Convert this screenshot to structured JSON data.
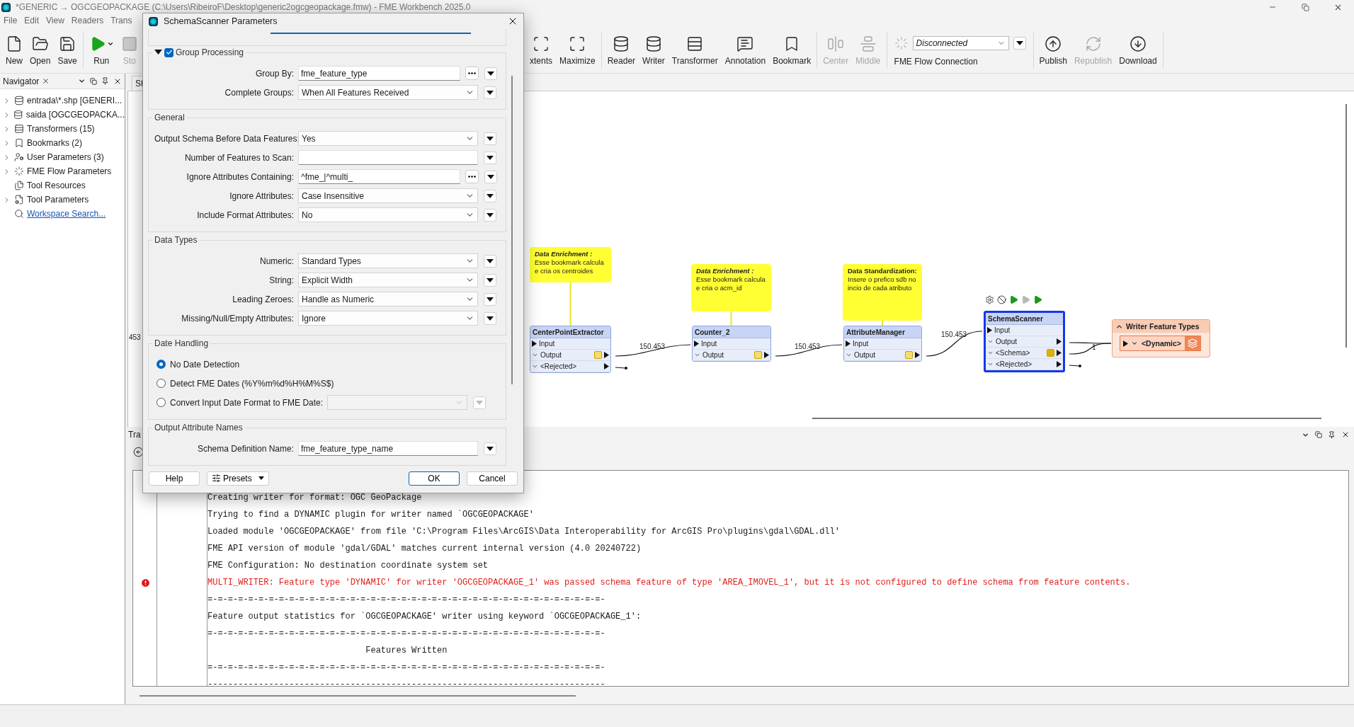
{
  "window": {
    "title": "*GENERIC → OGCGEOPACKAGE (C:\\Users\\RibeiroF\\Desktop\\generic2ogcgeopackage.fmw) - FME Workbench 2025.0"
  },
  "menu": [
    "File",
    "Edit",
    "View",
    "Readers",
    "Trans"
  ],
  "toolbar": {
    "groups": [
      {
        "items": [
          {
            "kind": "new",
            "label": "New",
            "disabled": false
          },
          {
            "kind": "open",
            "label": "Open",
            "disabled": false
          },
          {
            "kind": "save",
            "label": "Save",
            "disabled": false
          }
        ]
      },
      {
        "items": [
          {
            "kind": "run",
            "label": "Run",
            "disabled": false
          },
          {
            "kind": "stop",
            "label": "Sto",
            "disabled": true
          }
        ]
      },
      {
        "items": [
          {
            "kind": "extents",
            "label": "xtents",
            "disabled": false
          },
          {
            "kind": "maximize",
            "label": "Maximize",
            "disabled": false
          }
        ]
      },
      {
        "items": [
          {
            "kind": "reader",
            "label": "Reader",
            "disabled": false
          },
          {
            "kind": "writer",
            "label": "Writer",
            "disabled": false
          },
          {
            "kind": "transformer",
            "label": "Transformer",
            "disabled": false
          },
          {
            "kind": "annotation",
            "label": "Annotation",
            "disabled": false
          },
          {
            "kind": "bookmark",
            "label": "Bookmark",
            "disabled": false
          }
        ]
      },
      {
        "items": [
          {
            "kind": "center",
            "label": "Center",
            "disabled": true
          },
          {
            "kind": "middle",
            "label": "Middle",
            "disabled": true
          }
        ]
      }
    ],
    "flow_connection": {
      "value": "Disconnected",
      "label": "FME Flow Connection",
      "connected": false
    },
    "publish": {
      "items": [
        {
          "kind": "publish",
          "label": "Publish",
          "disabled": false
        },
        {
          "kind": "republish",
          "label": "Republish",
          "disabled": true
        },
        {
          "kind": "download",
          "label": "Download",
          "disabled": false
        }
      ]
    }
  },
  "navigator": {
    "title": "Navigator",
    "items": [
      {
        "kind": "reader",
        "label": "entrada\\*.shp [GENERI...",
        "expandable": true
      },
      {
        "kind": "writer",
        "label": "saida [OGCGEOPACKA...",
        "expandable": true
      },
      {
        "kind": "transformers",
        "label": "Transformers (15)",
        "expandable": true
      },
      {
        "kind": "bookmarks",
        "label": "Bookmarks (2)",
        "expandable": true
      },
      {
        "kind": "user_parameters",
        "label": "User Parameters (3)",
        "expandable": true
      },
      {
        "kind": "flow_parameters",
        "label": "FME Flow Parameters",
        "expandable": true
      },
      {
        "kind": "resources",
        "label": "Tool Resources",
        "expandable": false
      },
      {
        "kind": "tool_parameters",
        "label": "Tool Parameters",
        "expandable": true
      },
      {
        "kind": "link",
        "label": "Workspace Search...",
        "expandable": false
      }
    ]
  },
  "canvas": {
    "tab": "St",
    "edge_label": "453",
    "annotations": [
      {
        "title": "Data Enrichment :",
        "italic": true,
        "body": "Esse bookmark calcula e cria os centroides"
      },
      {
        "title": "Data Enrichment :",
        "italic": true,
        "body": "Esse bookmark calcula e cria o acm_id"
      },
      {
        "title": "Data Standardization:",
        "italic": false,
        "body": "Insere o prefico sdb no incio de cada atributo"
      }
    ],
    "nodes": [
      {
        "name": "CenterPointExtractor",
        "selected": false,
        "ports": [
          {
            "kind": "input",
            "label": "Input"
          },
          {
            "kind": "output",
            "label": "Output",
            "cached": true,
            "stale": true
          },
          {
            "kind": "output",
            "label": "<Rejected>",
            "cached": false
          }
        ]
      },
      {
        "name": "Counter_2",
        "selected": false,
        "ports": [
          {
            "kind": "input",
            "label": "Input"
          },
          {
            "kind": "output",
            "label": "Output",
            "cached": true,
            "stale": true
          }
        ]
      },
      {
        "name": "AttributeManager",
        "selected": false,
        "ports": [
          {
            "kind": "input",
            "label": "Input"
          },
          {
            "kind": "output",
            "label": "Output",
            "cached": true,
            "stale": true
          }
        ]
      },
      {
        "name": "SchemaScanner",
        "selected": true,
        "ports": [
          {
            "kind": "input",
            "label": "Input"
          },
          {
            "kind": "output",
            "label": "Output",
            "cached": false
          },
          {
            "kind": "output",
            "label": "<Schema>",
            "cached": true,
            "stale": false
          },
          {
            "kind": "output",
            "label": "<Rejected>",
            "cached": false
          }
        ]
      }
    ],
    "links": [
      {
        "count": "150.453"
      },
      {
        "count": "150.453"
      },
      {
        "count": "150.453"
      },
      {
        "count": "1"
      }
    ],
    "writer": {
      "title": "Writer Feature Types",
      "expanded": true,
      "feature_type": "<Dynamic>"
    }
  },
  "bottom_panel": {
    "tab": "Tra",
    "log": [
      {
        "kind": "info",
        "text": "Creating writer for format: OGC GeoPackage"
      },
      {
        "kind": "info",
        "text": "Trying to find a DYNAMIC plugin for writer named `OGCGEOPACKAGE'"
      },
      {
        "kind": "info",
        "text": "Loaded module 'OGCGEOPACKAGE' from file 'C:\\Program Files\\ArcGIS\\Data Interoperability for ArcGIS Pro\\plugins\\gdal\\GDAL.dll'"
      },
      {
        "kind": "info",
        "text": "FME API version of module 'gdal/GDAL' matches current internal version (4.0 20240722)"
      },
      {
        "kind": "info",
        "text": "FME Configuration: No destination coordinate system set"
      },
      {
        "kind": "error",
        "text": "MULTI_WRITER: Feature type 'DYNAMIC' for writer 'OGCGEOPACKAGE_1' was passed schema feature of type 'AREA_IMOVEL_1', but it is not configured to define schema from feature contents."
      },
      {
        "kind": "info",
        "text": "=-=-=-=-=-=-=-=-=-=-=-=-=-=-=-=-=-=-=-=-=-=-=-=-=-=-=-=-=-=-=-=-=-=-=-=-=-=-=-"
      },
      {
        "kind": "info",
        "text": "Feature output statistics for `OGCGEOPACKAGE' writer using keyword `OGCGEOPACKAGE_1':"
      },
      {
        "kind": "info",
        "text": "=-=-=-=-=-=-=-=-=-=-=-=-=-=-=-=-=-=-=-=-=-=-=-=-=-=-=-=-=-=-=-=-=-=-=-=-=-=-=-"
      },
      {
        "kind": "info",
        "text": "                               Features Written"
      },
      {
        "kind": "info",
        "text": "=-=-=-=-=-=-=-=-=-=-=-=-=-=-=-=-=-=-=-=-=-=-=-=-=-=-=-=-=-=-=-=-=-=-=-=-=-=-=-"
      },
      {
        "kind": "info",
        "text": "------------------------------------------------------------------------------"
      }
    ]
  },
  "dialog": {
    "title": "SchemaScanner Parameters",
    "sections": [
      {
        "kind": "checkable",
        "title": "Group Processing",
        "expanded": true,
        "checked": true,
        "rows": [
          {
            "kind": "text_browse",
            "label": "Group By:",
            "value": "fme_feature_type"
          },
          {
            "kind": "select",
            "label": "Complete Groups:",
            "value": "When All Features Received"
          }
        ]
      },
      {
        "kind": "plain",
        "title": "General",
        "rows": [
          {
            "kind": "select",
            "label": "Output Schema Before Data Features:",
            "value": "Yes"
          },
          {
            "kind": "text",
            "label": "Number of Features to Scan:"
          },
          {
            "kind": "text_browse",
            "label": "Ignore Attributes Containing:",
            "value": "^fme_|^multi_"
          },
          {
            "kind": "select",
            "label": "Ignore Attributes:",
            "value": "Case Insensitive"
          },
          {
            "kind": "select",
            "label": "Include Format Attributes:",
            "value": "No"
          }
        ]
      },
      {
        "kind": "plain",
        "title": "Data Types",
        "rows": [
          {
            "kind": "select",
            "label": "Numeric:",
            "value": "Standard Types"
          },
          {
            "kind": "select",
            "label": "String:",
            "value": "Explicit Width"
          },
          {
            "kind": "select",
            "label": "Leading Zeroes:",
            "value": "Handle as Numeric"
          },
          {
            "kind": "select",
            "label": "Missing/Null/Empty Attributes:",
            "value": "Ignore"
          }
        ]
      },
      {
        "kind": "plain",
        "title": "Date Handling",
        "options": [
          {
            "kind": "plain",
            "label": "No Date Detection",
            "selected": true
          },
          {
            "kind": "plain",
            "label": "Detect FME Dates (%Y%m%d%H%M%S$)",
            "selected": false
          },
          {
            "kind": "select",
            "label": "Convert Input Date Format to FME Date:",
            "selected": false,
            "disabled": true
          }
        ]
      },
      {
        "kind": "plain",
        "title": "Output Attribute Names",
        "rows": [
          {
            "kind": "text",
            "label": "Schema Definition Name:",
            "value": "fme_feature_type_name"
          }
        ]
      }
    ],
    "buttons": [
      {
        "kind": "help",
        "label": "Help",
        "default": false
      },
      {
        "kind": "presets",
        "label": "Presets",
        "default": false
      },
      {
        "kind": "ok",
        "label": "OK",
        "default": true
      },
      {
        "kind": "cancel",
        "label": "Cancel",
        "default": false
      }
    ]
  }
}
